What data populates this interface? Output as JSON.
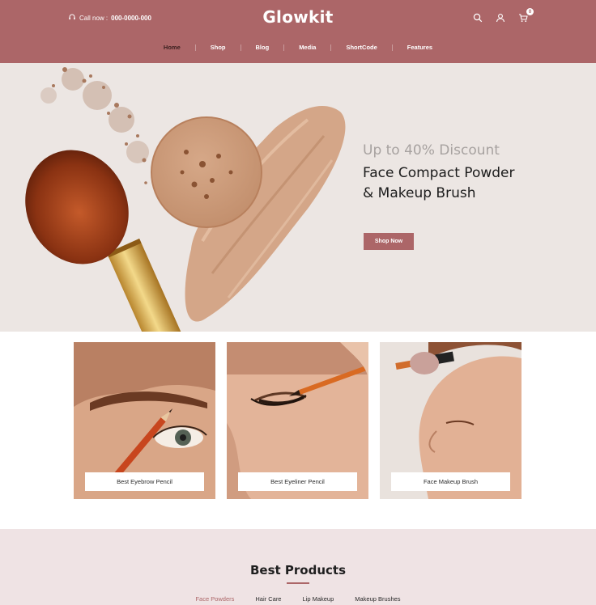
{
  "header": {
    "call_label": "Call now :",
    "call_number": "000-0000-000",
    "logo": "Glowkit",
    "cart_count": "0",
    "icons": [
      "headset-icon",
      "search-icon",
      "user-icon",
      "cart-icon"
    ]
  },
  "nav": [
    {
      "label": "Home"
    },
    {
      "label": "Shop"
    },
    {
      "label": "Blog"
    },
    {
      "label": "Media"
    },
    {
      "label": "ShortCode"
    },
    {
      "label": "Features"
    }
  ],
  "hero": {
    "subtitle": "Up to 40% Discount",
    "title_line1": "Face Compact Powder",
    "title_line2": "& Makeup Brush",
    "button": "Shop Now"
  },
  "categories": [
    {
      "label": "Best Eyebrow Pencil"
    },
    {
      "label": "Best Eyeliner Pencil"
    },
    {
      "label": "Face Makeup Brush"
    }
  ],
  "products": {
    "title": "Best Products",
    "tabs": [
      {
        "label": "Face Powders"
      },
      {
        "label": "Hair Care"
      },
      {
        "label": "Lip Makeup"
      },
      {
        "label": "Makeup Brushes"
      }
    ]
  },
  "colors": {
    "brand": "#ac6668",
    "hero_bg": "#ece6e3",
    "products_bg": "#efe3e4"
  }
}
